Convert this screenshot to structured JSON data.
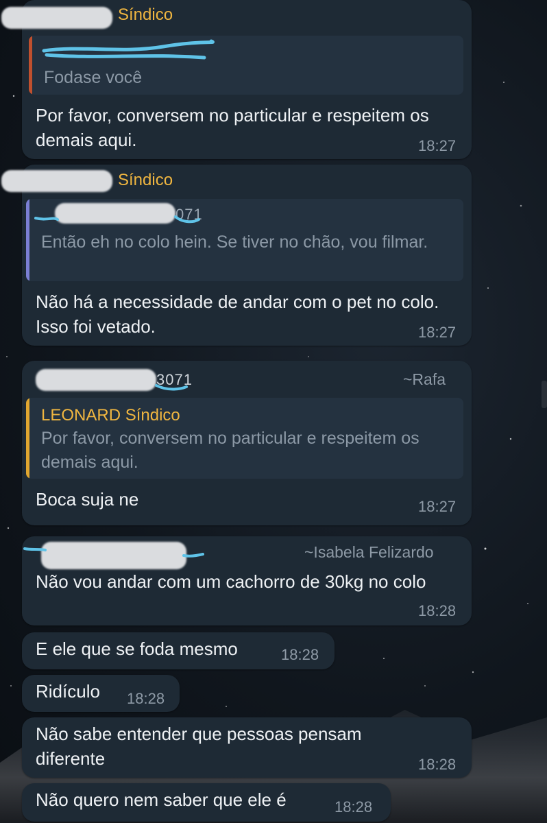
{
  "messages": [
    {
      "sender_name": "Síndico",
      "quote_text": "Fodase você",
      "text": "Por favor, conversem no particular e respeitem os demais aqui.",
      "time": "18:27"
    },
    {
      "sender_name": "Síndico",
      "quote_text": "Então eh no colo hein. Se tiver no chão, vou filmar.",
      "quote_number_suffix": "071",
      "text": "Não há a necessidade de andar com o pet no colo. Isso foi vetado.",
      "time": "18:27"
    },
    {
      "sender_number_suffix": "3071",
      "sender_handle": "~Rafa",
      "quote_name": "LEONARD Síndico",
      "quote_text": "Por favor, conversem no particular e respeitem os demais aqui.",
      "text": "Boca suja ne",
      "time": "18:27"
    },
    {
      "sender_handle": "~Isabela Felizardo",
      "text": "Não vou andar com um cachorro de 30kg no colo",
      "time": "18:28"
    },
    {
      "text": "E ele que se foda mesmo",
      "time": "18:28"
    },
    {
      "text": "Ridículo",
      "time": "18:28"
    },
    {
      "text": "Não sabe entender que pessoas pensam diferente",
      "time": "18:28"
    },
    {
      "text": "Não quero nem saber que ele é",
      "time": "18:28"
    }
  ],
  "colors": {
    "bubble": "#1e2a35",
    "sender_name": "#f0b640",
    "quote_bar_1": "#c0502e",
    "quote_bar_2": "#7b7fd4",
    "quote_bar_3": "#e0a630",
    "scribble": "#5fc3e8"
  }
}
